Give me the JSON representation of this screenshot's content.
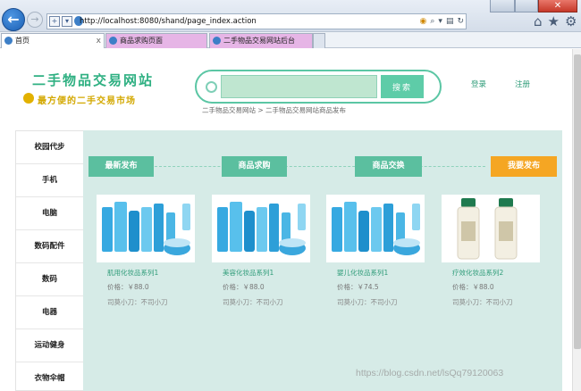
{
  "browser": {
    "url": "http://localhost:8080/shand/page_index.action",
    "tabs": [
      {
        "label": "首页"
      },
      {
        "label": "商品求购页面"
      },
      {
        "label": "二手物品交易网站后台"
      }
    ],
    "close_glyph": "x"
  },
  "header": {
    "site_title": "二手物品交易网站",
    "slogan": "最方便的二手交易市场",
    "search": {
      "placeholder": "",
      "button_label": "搜索"
    },
    "login_label": "登录",
    "register_label": "注册",
    "breadcrumb": "二手物品交易网站 > 二手物品交易网站商品发布"
  },
  "sidebar": {
    "items": [
      {
        "label": "校园代步"
      },
      {
        "label": "手机"
      },
      {
        "label": "电脑"
      },
      {
        "label": "数码配件"
      },
      {
        "label": "数码"
      },
      {
        "label": "电器"
      },
      {
        "label": "运动健身"
      },
      {
        "label": "衣物伞帽"
      }
    ]
  },
  "categories": [
    {
      "label": "最新发布",
      "color": "#5bbf9f"
    },
    {
      "label": "商品求购",
      "color": "#5bbf9f"
    },
    {
      "label": "商品交换",
      "color": "#5bbf9f"
    },
    {
      "label": "我要发布",
      "color": "#f5a623"
    }
  ],
  "products": [
    {
      "name": "肌用化妆品系列1",
      "price": "价格：￥88.0",
      "desc": "司莫小刀：不司小刀"
    },
    {
      "name": "美容化妆品系列1",
      "price": "价格：￥88.0",
      "desc": "司莫小刀：不司小刀"
    },
    {
      "name": "婴儿化妆品系列1",
      "price": "价格：￥74.5",
      "desc": "司莫小刀：不司小刀"
    },
    {
      "name": "疗效化妆品系列2",
      "price": "价格：￥88.0",
      "desc": "司莫小刀：不司小刀"
    }
  ],
  "watermark": "https://blog.csdn.net/lsQq79120063",
  "colors": {
    "accent": "#5bbf9f",
    "publish": "#f5a623",
    "main_bg": "#d6ebe7"
  }
}
